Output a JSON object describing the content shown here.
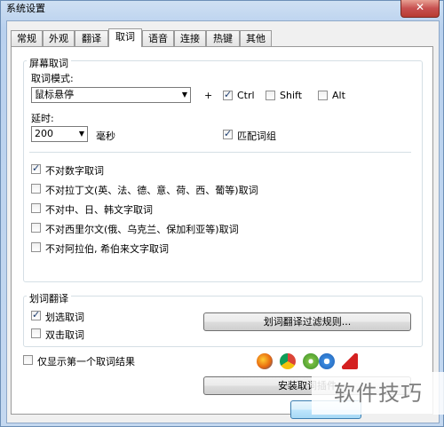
{
  "window": {
    "title": "系统设置",
    "close_glyph": "✕"
  },
  "tabs": [
    {
      "label": "常规"
    },
    {
      "label": "外观"
    },
    {
      "label": "翻译"
    },
    {
      "label": "取词"
    },
    {
      "label": "语音"
    },
    {
      "label": "连接"
    },
    {
      "label": "热键"
    },
    {
      "label": "其他"
    }
  ],
  "screen_group": {
    "title": "屏幕取词",
    "mode_label": "取词模式:",
    "mode_value": "鼠标悬停",
    "plus": "+",
    "ctrl_label": "Ctrl",
    "ctrl_checked": true,
    "shift_label": "Shift",
    "shift_checked": false,
    "alt_label": "Alt",
    "alt_checked": false,
    "delay_label": "延时:",
    "delay_value": "200",
    "delay_unit": "毫秒",
    "phrase_label": "匹配词组",
    "phrase_checked": true,
    "options": [
      {
        "label": "不对数字取词",
        "checked": true
      },
      {
        "label": "不对拉丁文(英、法、德、意、荷、西、葡等)取词",
        "checked": false
      },
      {
        "label": "不对中、日、韩文字取词",
        "checked": false
      },
      {
        "label": "不对西里尔文(俄、乌克兰、保加利亚等)取词",
        "checked": false
      },
      {
        "label": "不对阿拉伯, 希伯来文字取词",
        "checked": false
      }
    ]
  },
  "select_group": {
    "title": "划词翻译",
    "select_label": "划选取词",
    "select_checked": true,
    "dblclick_label": "双击取词",
    "dblclick_checked": false,
    "filter_button": "划词翻译过滤规则..."
  },
  "first_result_label": "仅显示第一个取词结果",
  "first_result_checked": false,
  "install_button": "安装取词插件",
  "browser_icons": [
    "firefox-icon",
    "chrome-icon",
    "360-browser-icon",
    "ie-icon",
    "acrobat-icon"
  ],
  "watermark": "软件技巧",
  "colors": {
    "title_bar": "#b9d1ee",
    "close": "#c75050",
    "panel": "#ffffff"
  }
}
